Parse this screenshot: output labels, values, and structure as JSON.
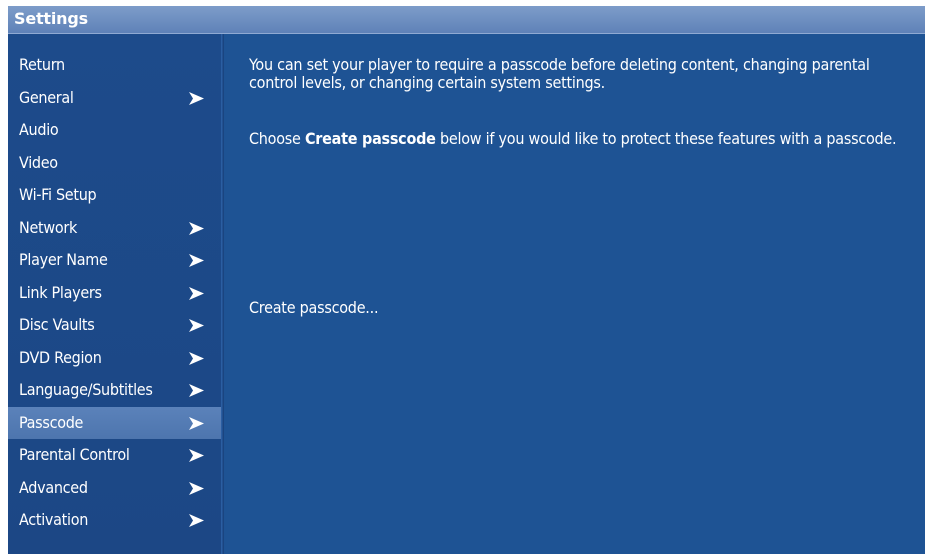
{
  "window": {
    "title": "Settings"
  },
  "sidebar": {
    "items": [
      {
        "label": "Return",
        "has_arrow": false,
        "selected": false
      },
      {
        "label": "General",
        "has_arrow": true,
        "selected": false
      },
      {
        "label": "Audio",
        "has_arrow": false,
        "selected": false
      },
      {
        "label": "Video",
        "has_arrow": false,
        "selected": false
      },
      {
        "label": "Wi-Fi Setup",
        "has_arrow": false,
        "selected": false
      },
      {
        "label": "Network",
        "has_arrow": true,
        "selected": false
      },
      {
        "label": "Player Name",
        "has_arrow": true,
        "selected": false
      },
      {
        "label": "Link Players",
        "has_arrow": true,
        "selected": false
      },
      {
        "label": "Disc Vaults",
        "has_arrow": true,
        "selected": false
      },
      {
        "label": "DVD Region",
        "has_arrow": true,
        "selected": false
      },
      {
        "label": "Language/Subtitles",
        "has_arrow": true,
        "selected": false
      },
      {
        "label": "Passcode",
        "has_arrow": true,
        "selected": true
      },
      {
        "label": "Parental Control",
        "has_arrow": true,
        "selected": false
      },
      {
        "label": "Advanced",
        "has_arrow": true,
        "selected": false
      },
      {
        "label": "Activation",
        "has_arrow": true,
        "selected": false
      }
    ],
    "arrow_icon": "chevron-right-icon"
  },
  "main": {
    "description": "You can set your player to require a passcode before deleting content, changing parental control levels, or changing certain system settings.",
    "instruction_prefix": "Choose ",
    "instruction_bold": "Create passcode",
    "instruction_suffix": " below if you would like to protect these features with a passcode.",
    "create_button_label": "Create passcode..."
  },
  "colors": {
    "background": "#1f5193",
    "titlebar": "#6d8fc2",
    "selected_item": "#5479b3",
    "text": "#ffffff"
  }
}
